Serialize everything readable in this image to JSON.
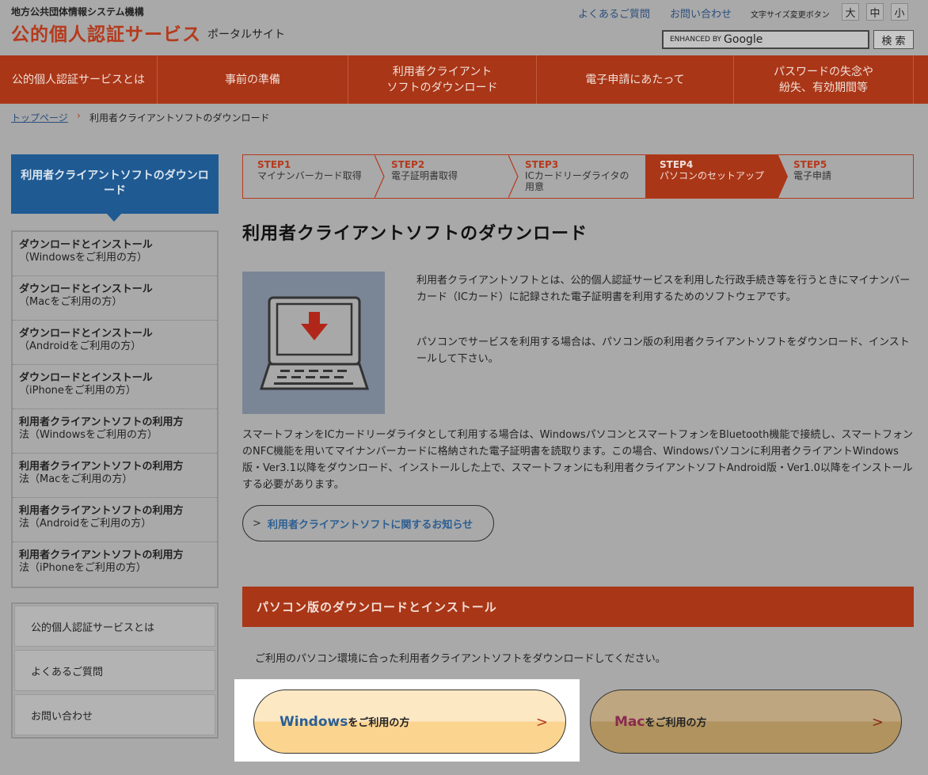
{
  "header": {
    "org": "地方公共団体情報システム機構",
    "title": "公的個人認証サービス",
    "subtitle": "ポータルサイト",
    "faq_link": "よくあるご質問",
    "contact_link": "お問い合わせ",
    "font_size_label": "文字サイズ変更ボタン",
    "font_sizes": [
      "大",
      "中",
      "小"
    ],
    "search_enhanced": "ENHANCED BY",
    "search_google": "Google",
    "search_button": "検 索"
  },
  "nav": [
    {
      "label": "公的個人認証サービスとは"
    },
    {
      "label": "事前の準備"
    },
    {
      "label": "利用者クライアント\nソフトのダウンロード"
    },
    {
      "label": "電子申請にあたって"
    },
    {
      "label": "パスワードの失念や\n紛失、有効期間等"
    }
  ],
  "breadcrumb": {
    "home": "トップページ",
    "separator": "›",
    "current": "利用者クライアントソフトのダウンロード"
  },
  "sidebar": {
    "heading": "利用者クライアントソフトのダウンロード",
    "items": [
      {
        "l1": "ダウンロードとインストール",
        "l2": "（Windowsをご利用の方）"
      },
      {
        "l1": "ダウンロードとインストール",
        "l2": "（Macをご利用の方）"
      },
      {
        "l1": "ダウンロードとインストール",
        "l2": "（Androidをご利用の方）"
      },
      {
        "l1": "ダウンロードとインストール",
        "l2": "（iPhoneをご利用の方）"
      },
      {
        "l1": "利用者クライアントソフトの利用方",
        "l2": "法（Windowsをご利用の方）"
      },
      {
        "l1": "利用者クライアントソフトの利用方",
        "l2": "法（Macをご利用の方）"
      },
      {
        "l1": "利用者クライアントソフトの利用方",
        "l2": "法（Androidをご利用の方）"
      },
      {
        "l1": "利用者クライアントソフトの利用方",
        "l2": "法（iPhoneをご利用の方）"
      }
    ],
    "links": [
      "公的個人認証サービスとは",
      "よくあるご質問",
      "お問い合わせ"
    ]
  },
  "steps": [
    {
      "num": "STEP1",
      "text": "マイナンバーカード取得"
    },
    {
      "num": "STEP2",
      "text": "電子証明書取得"
    },
    {
      "num": "STEP3",
      "text": "ICカードリーダライタの用意"
    },
    {
      "num": "STEP4",
      "text": "パソコンのセットアップ",
      "active": true
    },
    {
      "num": "STEP5",
      "text": "電子申請"
    }
  ],
  "main": {
    "title": "利用者クライアントソフトのダウンロード",
    "para1": "利用者クライアントソフトとは、公的個人認証サービスを利用した行政手続き等を行うときにマイナンバーカード（ICカード）に記録された電子証明書を利用するためのソフトウェアです。",
    "para2": "パソコンでサービスを利用する場合は、パソコン版の利用者クライアントソフトをダウンロード、インストールして下さい。",
    "para3": "スマートフォンをICカードリーダライタとして利用する場合は、WindowsパソコンとスマートフォンをBluetooth機能で接続し、スマートフォンのNFC機能を用いてマイナンバーカードに格納された電子証明書を読取ります。この場合、Windowsパソコンに利用者クライアントWindows版・Ver3.1以降をダウンロード、インストールした上で、スマートフォンにも利用者クライアントソフトAndroid版・Ver1.0以降をインストールする必要があります。",
    "notice_button": "利用者クライアントソフトに関するお知らせ",
    "section_heading": "パソコン版のダウンロードとインストール",
    "section_desc": "ご利用のパソコン環境に合った利用者クライアントソフトをダウンロードしてください。",
    "windows_os": "Windows",
    "windows_suffix": "をご利用の方",
    "mac_os": "Mac",
    "mac_suffix": "をご利用の方"
  },
  "colors": {
    "brand": "#a93617",
    "accent_blue": "#1f5a93",
    "highlight": "#ffffff",
    "windows_text": "#2c5f93",
    "mac_text": "#8b2a4f"
  }
}
